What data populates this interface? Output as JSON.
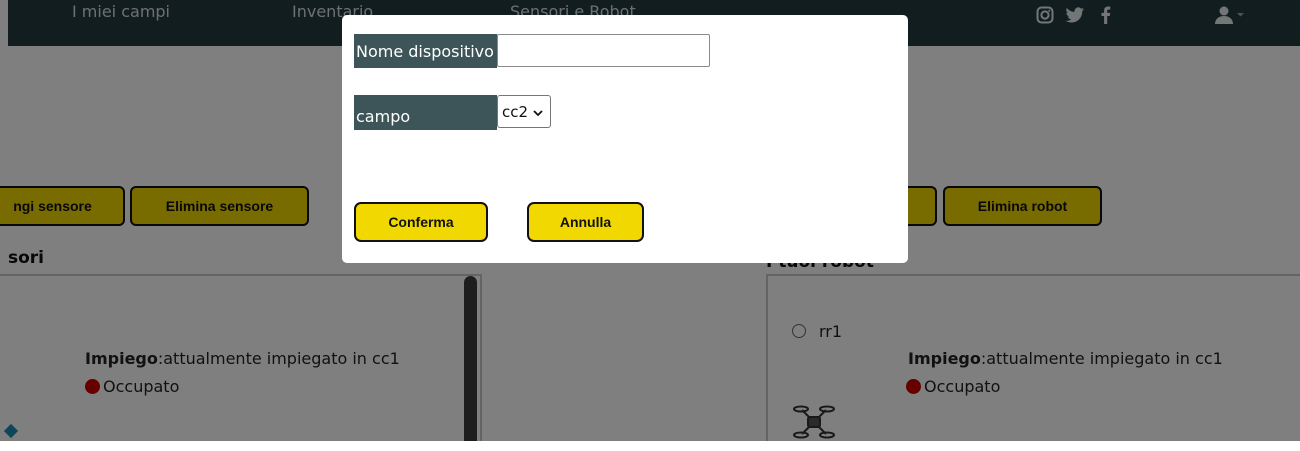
{
  "nav": {
    "links": [
      "I miei campi",
      "Inventario",
      "Sensori e Robot"
    ],
    "icons": [
      "instagram-icon",
      "twitter-icon",
      "facebook-icon",
      "user-icon"
    ]
  },
  "sensors": {
    "add_button": "Aggiungi sensore",
    "add_button_visible": "ngi sensore",
    "delete_button": "Elimina sensore",
    "title_visible": "sori",
    "item": {
      "impiego_label": "Impiego",
      "impiego_value": ":attualmente impiegato in cc1",
      "status": "Occupato"
    }
  },
  "robots": {
    "delete_button": "Elimina robot",
    "title_visible": "I tuoi robot",
    "item": {
      "name": "rr1",
      "impiego_label": "Impiego",
      "impiego_value": ":attualmente impiegato in cc1",
      "status": "Occupato"
    }
  },
  "modal": {
    "name_label": "Nome dispositivo",
    "name_value": "",
    "field_label": "campo",
    "field_selected": "cc2",
    "confirm_button": "Conferma",
    "cancel_button": "Annulla"
  },
  "colors": {
    "navbar": "#243b3e",
    "label_bg": "#3d5558",
    "button_yellow": "#f0d800",
    "status_busy": "#cc0000"
  }
}
